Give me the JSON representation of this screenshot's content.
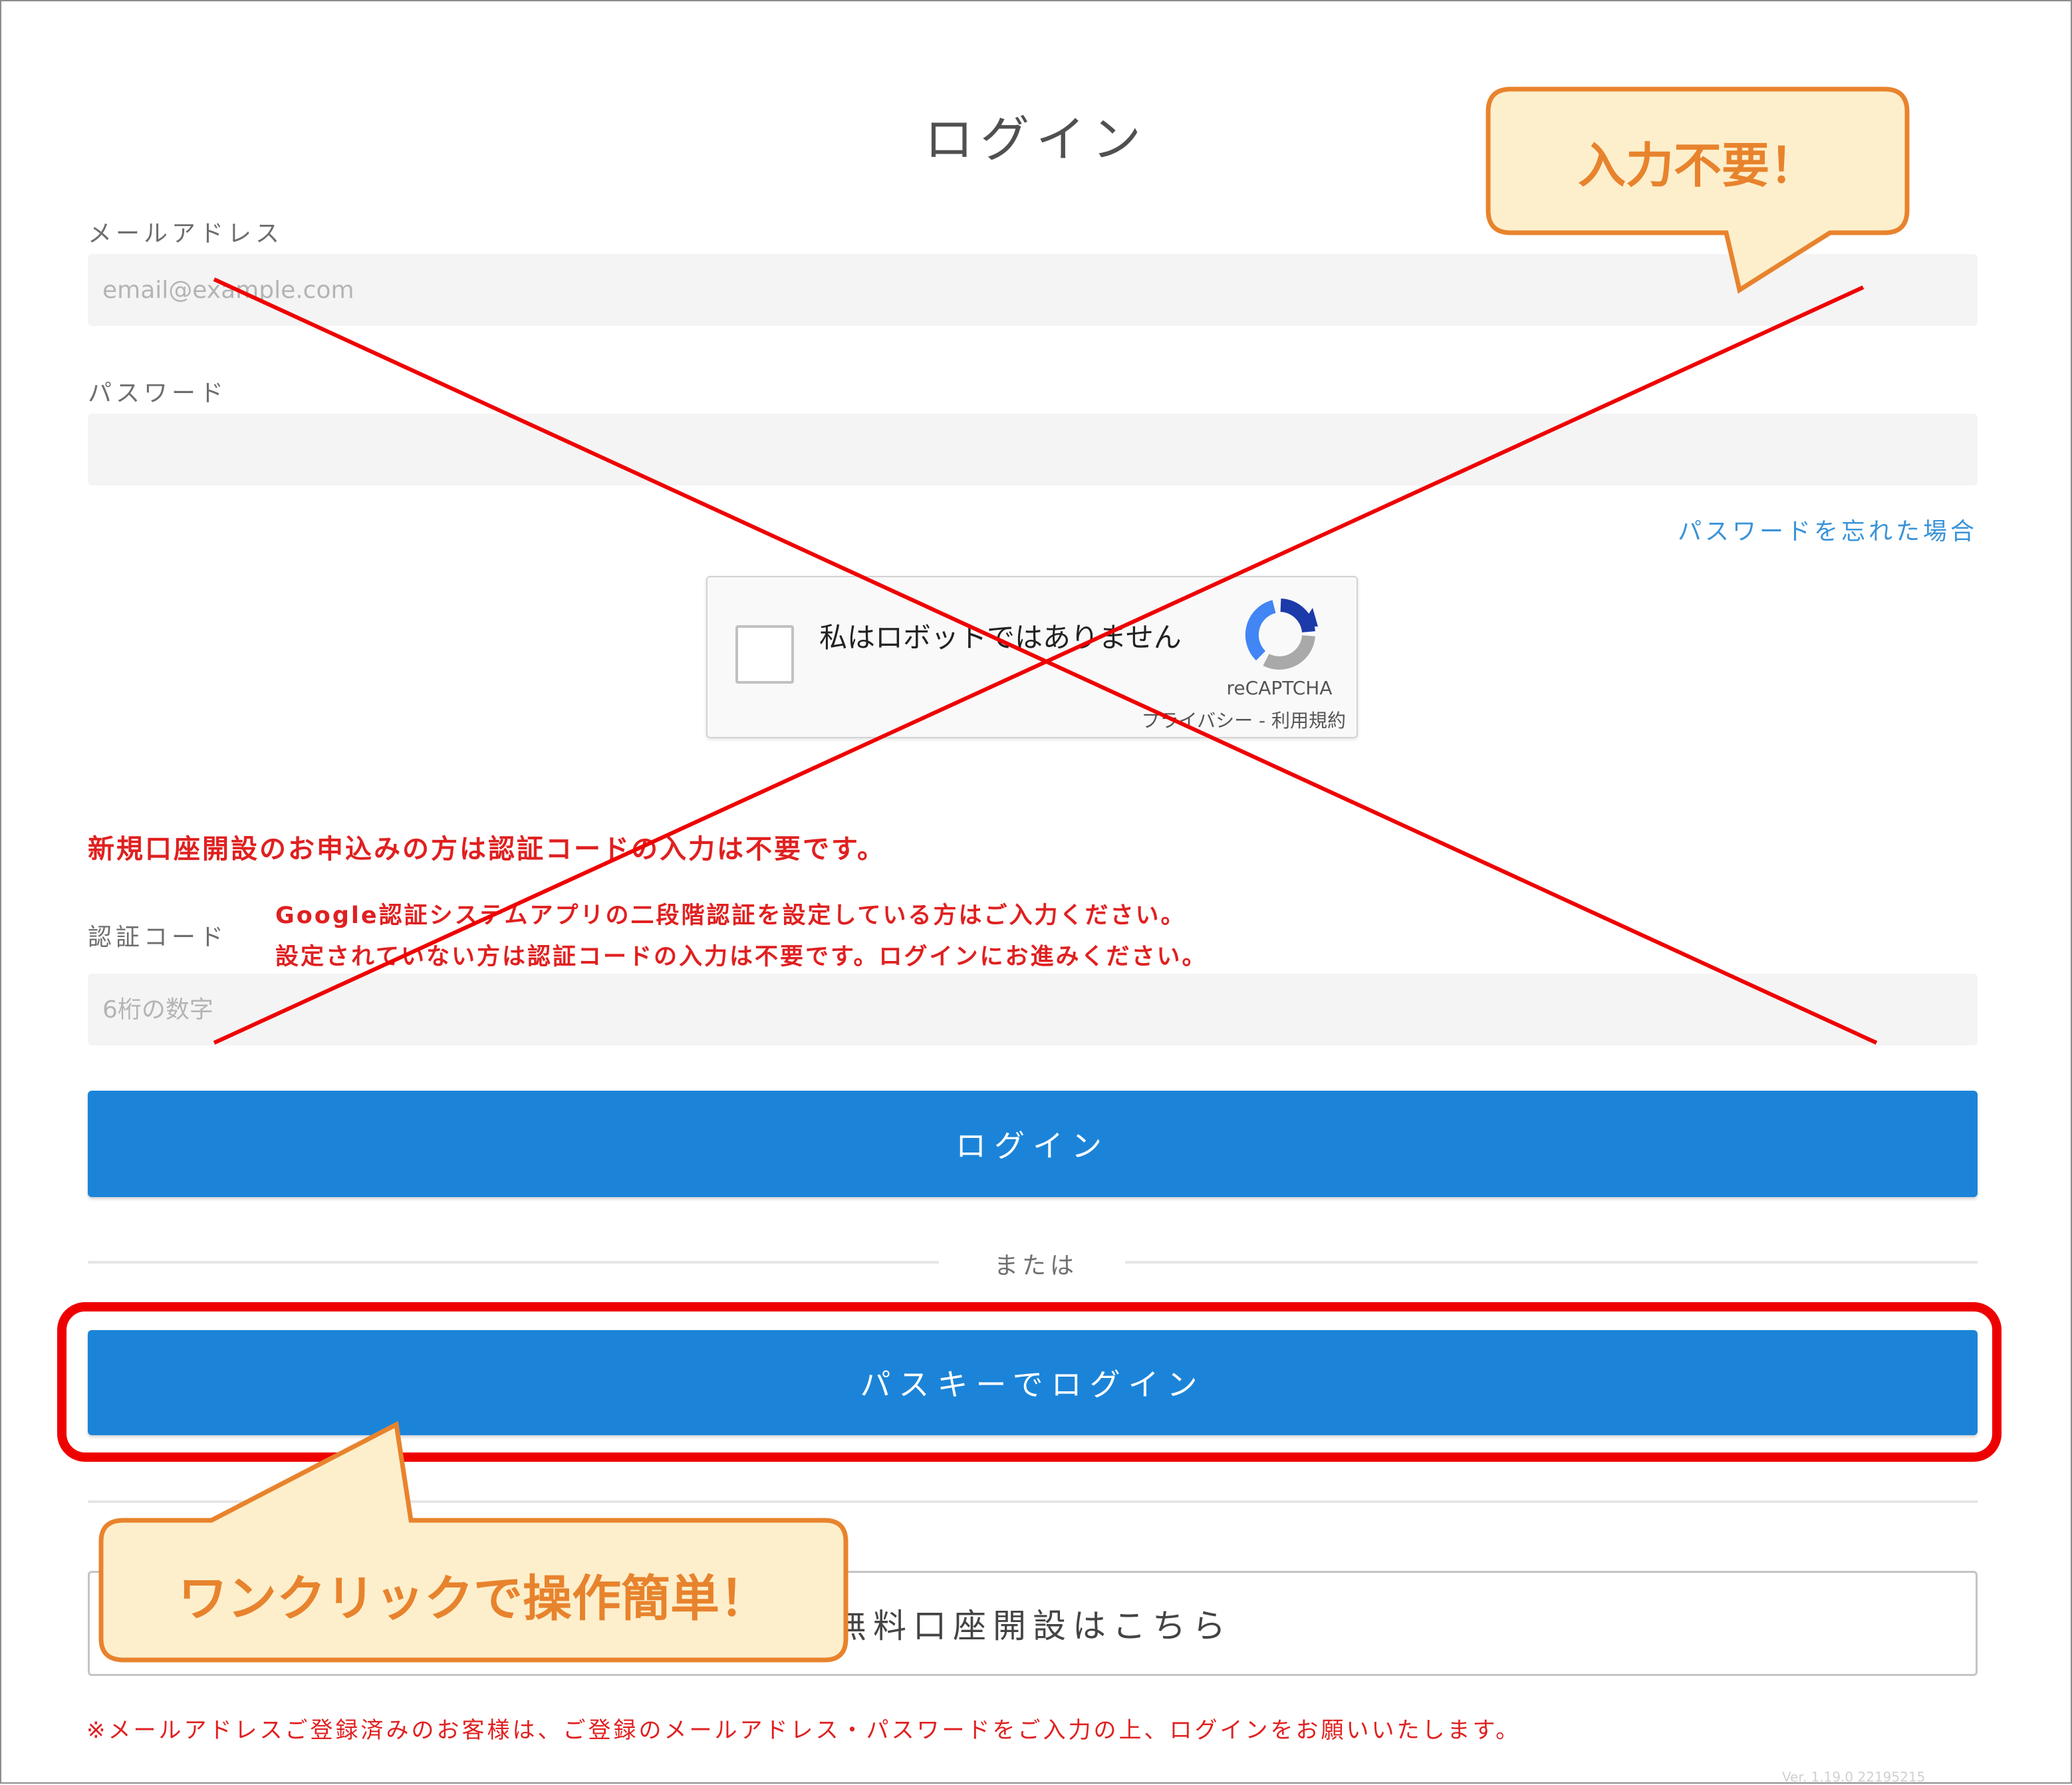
{
  "form": {
    "title": "ログイン",
    "email_label": "メールアドレス",
    "email_placeholder": "email@example.com",
    "password_label": "パスワード",
    "forgot_password": "パスワードを忘れた場合",
    "recaptcha": {
      "checkbox_text": "私はロボットではありません",
      "brand": "reCAPTCHA",
      "terms": "プライバシー - 利用規約"
    },
    "new_account_notice": "新規口座開設のお申込みの方は認証コードの入力は不要です。",
    "auth_code_label": "認証コード",
    "auth_note_line1": "Google認証システムアプリの二段階認証を設定している方はご入力ください。",
    "auth_note_line2": "設定されていない方は認証コードの入力は不要です。ログインにお進みください。",
    "auth_code_placeholder": "6桁の数字",
    "login_button": "ログイン",
    "or_text": "または",
    "passkey_button": "パスキーでログイン",
    "signup_button": "無料口座開設はこちら",
    "footer_notice": "※メールアドレスご登録済みのお客様は、ご登録のメールアドレス・パスワードをご入力の上、ログインをお願いいたします。",
    "version": "Ver. 1.19.0 22195215"
  },
  "annotations": {
    "callout_top": "入力不要！",
    "callout_bottom": "ワンクリックで操作簡単！"
  },
  "colors": {
    "primary_button": "#1b84d8",
    "link": "#3a93d8",
    "alert_red": "#e02020",
    "highlight_red": "#ee0000",
    "callout_fill": "#fdefcc",
    "callout_border": "#e8832d"
  }
}
